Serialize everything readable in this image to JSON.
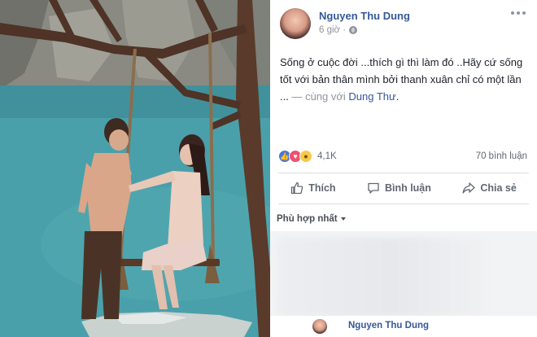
{
  "post": {
    "author": "Nguyen Thu Dung",
    "time": "6 giờ ·",
    "privacy_icon": "globe-icon",
    "text_main": "Sống ở cuộc đời ...thích gì thì làm đó ..Hãy cứ sống tốt với bản thân mình bởi thanh xuân chỉ có một lần ...",
    "text_with": " — cùng với ",
    "tagged": "Dung Thư",
    "text_end": "."
  },
  "stats": {
    "reaction_count": "4,1K",
    "reactions": [
      "like-icon",
      "love-icon",
      "wow-icon"
    ],
    "comments": "70 bình luận"
  },
  "actions": {
    "like": "Thích",
    "comment": "Bình luận",
    "share": "Chia sẻ"
  },
  "comments": {
    "sort": "Phù hợp nhất",
    "reply_author": "Nguyen Thu Dung"
  },
  "colors": {
    "link": "#365899",
    "meta": "#90949c",
    "like": "#4a78d8",
    "love": "#f0506e",
    "wow": "#f7c84a"
  }
}
